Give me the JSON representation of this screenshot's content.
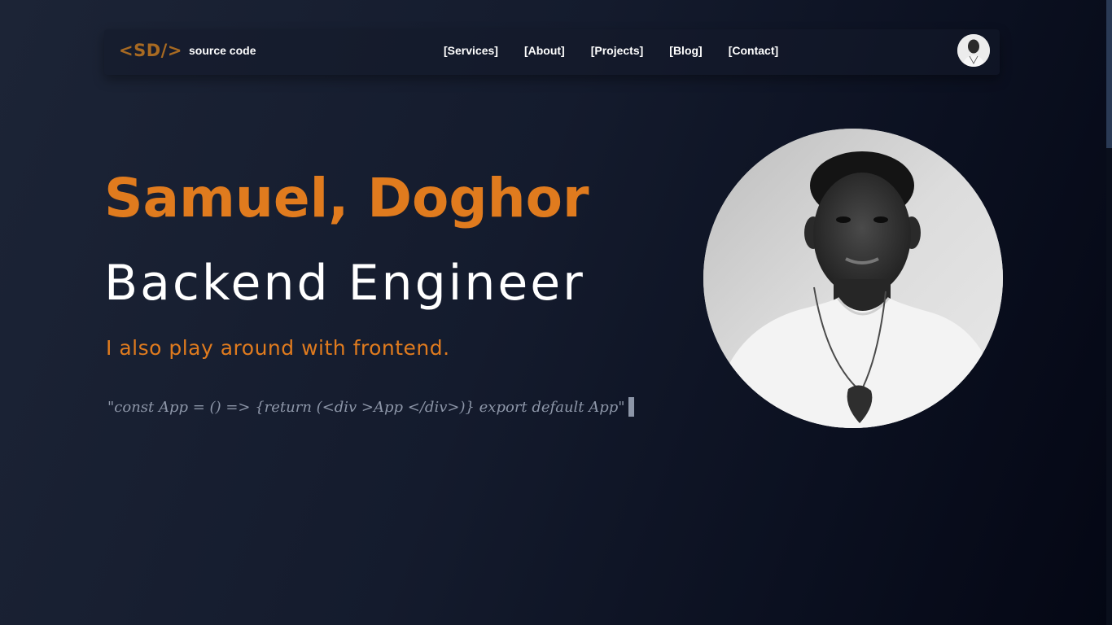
{
  "nav": {
    "logo": "<SD/>",
    "logo_sub": "source code",
    "links": [
      {
        "label": "[Services]"
      },
      {
        "label": "[About]"
      },
      {
        "label": "[Projects]"
      },
      {
        "label": "[Blog]"
      },
      {
        "label": "[Contact]"
      }
    ]
  },
  "hero": {
    "name": "Samuel, Doghor",
    "title": "Backend Engineer",
    "subtitle": "I also play around with frontend.",
    "code_line": "\"const App = () => {return (<div >App </div>)} export default App\""
  },
  "colors": {
    "accent": "#e07b1e",
    "background_dark": "#141b2d",
    "text_muted": "#8d96a8"
  }
}
